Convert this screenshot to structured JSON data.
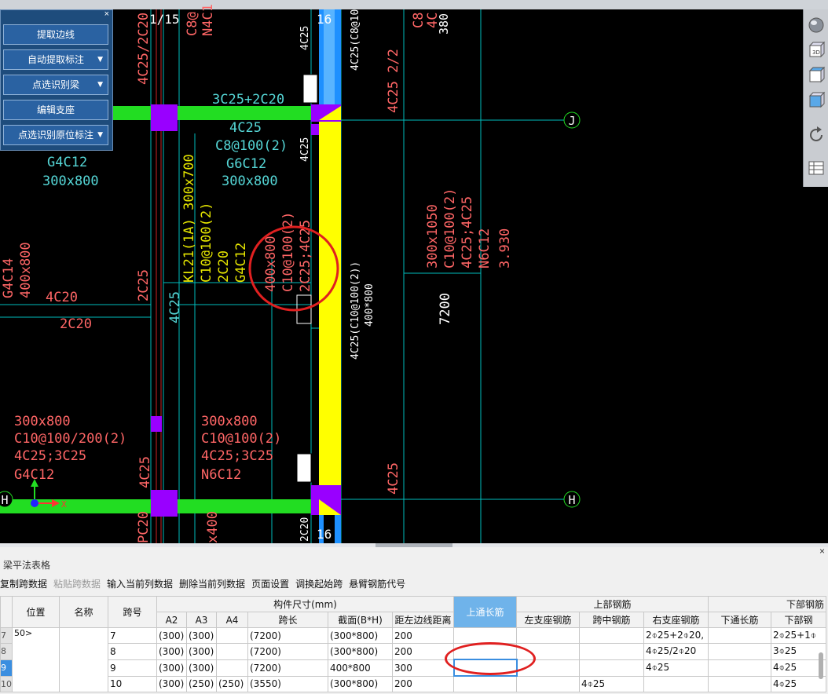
{
  "cad": {
    "axis_labels": {
      "top_a": "1/15",
      "top_b": "16",
      "bottom_b": "16",
      "bubble_j": "J",
      "bubble_h_right": "H",
      "bubble_h_left": "H"
    },
    "ucs": {
      "x": "X"
    },
    "texts": {
      "t1": "C8@",
      "t2": "N4C1",
      "t3": "4C25/2C20",
      "t4": "3C25+2C20",
      "t5": "4C25",
      "t6": "C8@100(2)",
      "t7": "G6C12",
      "t8": "300x800",
      "t9": "G4C12",
      "t10": "300x800",
      "t11": "KL21(1A) 300x700",
      "t12": "C10@100(2)",
      "t13": "2C20",
      "t14": "G4C12",
      "t15": "400x800",
      "t16": "C10@100(2)",
      "t17": "2C25;4C25",
      "t18": "4C25",
      "t19": "4C25(C8@10",
      "t20": "4C25 2/2",
      "t21": "C8",
      "t22": "4C",
      "t23": "380",
      "t24": "300x1050",
      "t25": "C10@100(2)",
      "t26": "4C25;4C25",
      "t27": "N6C12",
      "t28": "3.930",
      "t29": "4C25(C10@100(2))",
      "t30": "400*800",
      "t31": "7200",
      "t32": "G4C14",
      "t33": "400x800",
      "t34": "4C20",
      "t35": "2C25",
      "t36": "2C20",
      "t37": "4C25",
      "t38": "300x800",
      "t39": "C10@100/200(2)",
      "t40": "4C25;3C25",
      "t41": "G4C12",
      "t42": "300x800",
      "t43": "C10@100(2)",
      "t44": "4C25;3C25",
      "t45": "N6C12",
      "t46": "4C25",
      "t47": "4C25",
      "t48": "2C20",
      "t49": "PC20",
      "t50": "x400"
    }
  },
  "command_panel": {
    "close": "×",
    "buttons": [
      {
        "label": "提取边线",
        "dropdown": false
      },
      {
        "label": "自动提取标注",
        "dropdown": true
      },
      {
        "label": "点选识别梁",
        "dropdown": true
      },
      {
        "label": "编辑支座",
        "dropdown": false
      },
      {
        "label": "点选识别原位标注",
        "dropdown": true
      }
    ]
  },
  "right_toolbar": {
    "icons": [
      "render-sphere-icon",
      "view-3d-icon",
      "cube-top-icon",
      "cube-front-icon",
      "rotate-icon",
      "layer-table-icon"
    ]
  },
  "bottom_panel": {
    "close": "×",
    "title": "梁平法表格",
    "toolbar": [
      {
        "label": "复制跨数据",
        "disabled": false
      },
      {
        "label": "粘贴跨数据",
        "disabled": true
      },
      {
        "label": "输入当前列数据",
        "disabled": false
      },
      {
        "label": "删除当前列数据",
        "disabled": false
      },
      {
        "label": "页面设置",
        "disabled": false
      },
      {
        "label": "调换起始跨",
        "disabled": false
      },
      {
        "label": "悬臂钢筋代号",
        "disabled": false
      }
    ],
    "headers": {
      "position": "位置",
      "name": "名称",
      "span_no": "跨号",
      "size_group": "构件尺寸(mm)",
      "a2": "A2",
      "a3": "A3",
      "a4": "A4",
      "span_len": "跨长",
      "section": "截面(B*H)",
      "dist_left": "距左边线距离",
      "top_through": "上通长筋",
      "top_group": "上部钢筋",
      "left_support": "左支座钢筋",
      "mid_span": "跨中钢筋",
      "right_support": "右支座钢筋",
      "bottom_group": "下部钢筋",
      "bottom_through": "下通长筋",
      "bottom_rebar": "下部钢"
    },
    "rows": [
      {
        "idx": "7",
        "pos": "50>",
        "name": "",
        "span": "7",
        "a2": "(300)",
        "a3": "(300)",
        "a4": "",
        "len": "(7200)",
        "sec": "(300*800)",
        "dist": "200",
        "top": "",
        "left": "",
        "mid": "",
        "right": "2⌽25+2⌽20,",
        "bthru": "",
        "bot": "2⌽25+1⌽"
      },
      {
        "idx": "8",
        "pos": "",
        "name": "",
        "span": "8",
        "a2": "(300)",
        "a3": "(300)",
        "a4": "",
        "len": "(7200)",
        "sec": "(300*800)",
        "dist": "200",
        "top": "",
        "left": "",
        "mid": "",
        "right": "4⌽25/2⌽20",
        "bthru": "",
        "bot": "3⌽25"
      },
      {
        "idx": "9",
        "pos": "",
        "name": "",
        "span": "9",
        "a2": "(300)",
        "a3": "(300)",
        "a4": "",
        "len": "(7200)",
        "sec": "400*800",
        "dist": "300",
        "top": "",
        "left": "",
        "mid": "",
        "right": "4⌽25",
        "bthru": "",
        "bot": "4⌽25"
      },
      {
        "idx": "10",
        "pos": "",
        "name": "",
        "span": "10",
        "a2": "(300)",
        "a3": "(250)",
        "a4": "(250)",
        "len": "(3550)",
        "sec": "(300*800)",
        "dist": "200",
        "top": "",
        "left": "",
        "mid": "4⌽25",
        "right": "",
        "bthru": "",
        "bot": "4⌽25"
      }
    ],
    "selected_row": "9"
  },
  "colors": {
    "cad_bg": "#000000",
    "beam_green": "#22dd22",
    "column_magenta": "#9900ff",
    "yellow_beam": "#ffff00",
    "blue_beam": "#1e90ff",
    "axis_line": "#00cccc",
    "annot_red": "#ff6666",
    "annot_cyan": "#55d6d6",
    "annot_yellow": "#e6e600",
    "highlight_blue": "#6fb3ea",
    "callout_red": "#e02020"
  }
}
